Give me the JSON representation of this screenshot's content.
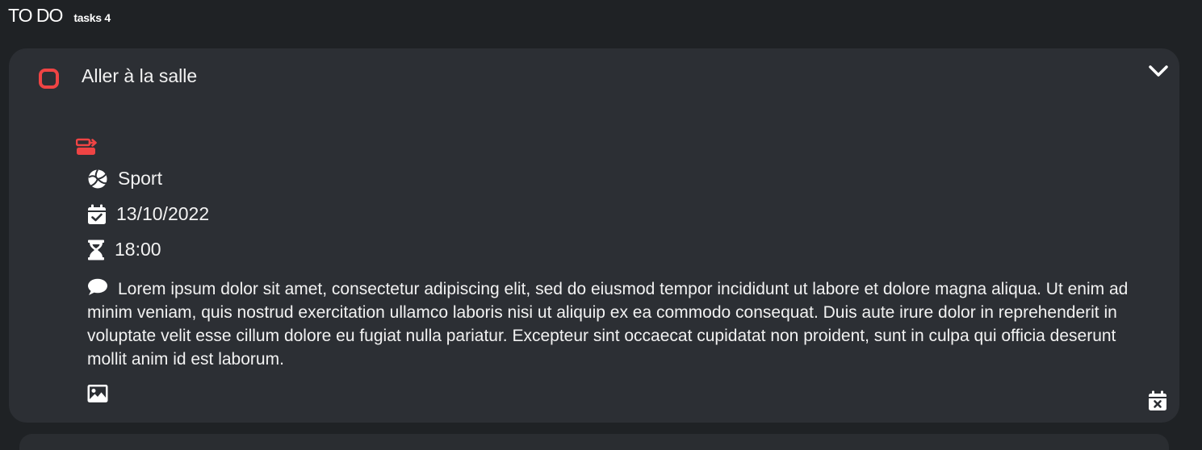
{
  "header": {
    "title": "TO DO",
    "tasks_count": "tasks 4"
  },
  "task": {
    "title": "Aller à la salle",
    "category": "Sport",
    "date": "13/10/2022",
    "time": "18:00",
    "description": "Lorem ipsum dolor sit amet, consectetur adipiscing elit, sed do eiusmod tempor incididunt ut labore et dolore magna aliqua. Ut enim ad minim veniam, quis nostrud exercitation ullamco laboris nisi ut aliquip ex ea commodo consequat. Duis aute irure dolor in reprehenderit in voluptate velit esse cillum dolore eu fugiat nulla pariatur. Excepteur sint occaecat cupidatat non proident, sunt in culpa qui officia deserunt mollit anim id est laborum.",
    "completed": false
  },
  "icons": {
    "checkbox": "checkbox-unchecked-icon",
    "expand": "chevron-down-icon",
    "transfer": "transfer-icon",
    "category": "volleyball-icon",
    "date": "calendar-check-icon",
    "time": "hourglass-icon",
    "description": "comment-icon",
    "image": "image-icon",
    "remove_date": "calendar-x-icon"
  },
  "colors": {
    "background": "#1f2225",
    "card": "#2c2f34",
    "accent": "#ef4444",
    "text": "#f2f2f2"
  }
}
